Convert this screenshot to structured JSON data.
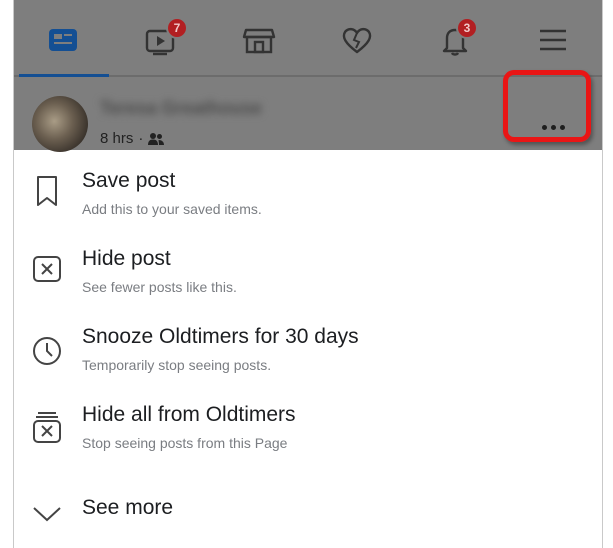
{
  "tabs": [
    {
      "name": "news-feed",
      "icon": "news-feed-icon",
      "active": true
    },
    {
      "name": "watch",
      "icon": "video-icon",
      "badge": "7"
    },
    {
      "name": "marketplace",
      "icon": "store-icon"
    },
    {
      "name": "dating",
      "icon": "heart-icon"
    },
    {
      "name": "notifications",
      "icon": "bell-icon",
      "badge": "3"
    },
    {
      "name": "menu",
      "icon": "hamburger-icon"
    }
  ],
  "post": {
    "author": "Teresa Greathouse",
    "time": "8 hrs",
    "separator": "·"
  },
  "menu": {
    "items": [
      {
        "title": "Save post",
        "subtitle": "Add this to your saved items."
      },
      {
        "title": "Hide post",
        "subtitle": "See fewer posts like this."
      },
      {
        "title": "Snooze Oldtimers for 30 days",
        "subtitle": "Temporarily stop seeing posts."
      },
      {
        "title": "Hide all from Oldtimers",
        "subtitle": "Stop seeing posts from this Page"
      }
    ],
    "see_more": "See more"
  },
  "colors": {
    "highlight": "#e91515",
    "active_tab": "#144f93",
    "badge": "#b21f22"
  }
}
